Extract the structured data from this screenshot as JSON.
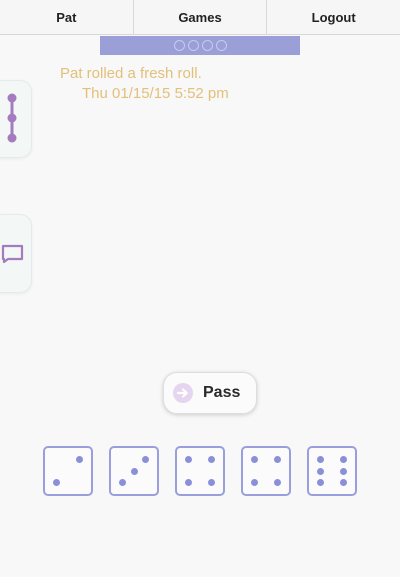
{
  "nav": {
    "user_label": "Pat",
    "games_label": "Games",
    "logout_label": "Logout"
  },
  "progress": {
    "total": 4,
    "filled": 0
  },
  "message": {
    "text": "Pat rolled a fresh roll.",
    "timestamp": "Thu 01/15/15 5:52 pm"
  },
  "side_tabs": [
    {
      "icon": "timeline-icon"
    },
    {
      "icon": "chat-bubble-icon"
    }
  ],
  "pass_button": {
    "label": "Pass",
    "icon": "arrow-right-circle-icon"
  },
  "dice": [
    2,
    3,
    4,
    4,
    6
  ],
  "colors": {
    "accent": "#9b9fd8",
    "die_border": "#9a9fdb",
    "pip": "#8a90d8",
    "message": "#e2c07a",
    "icon": "#a57bc0"
  }
}
